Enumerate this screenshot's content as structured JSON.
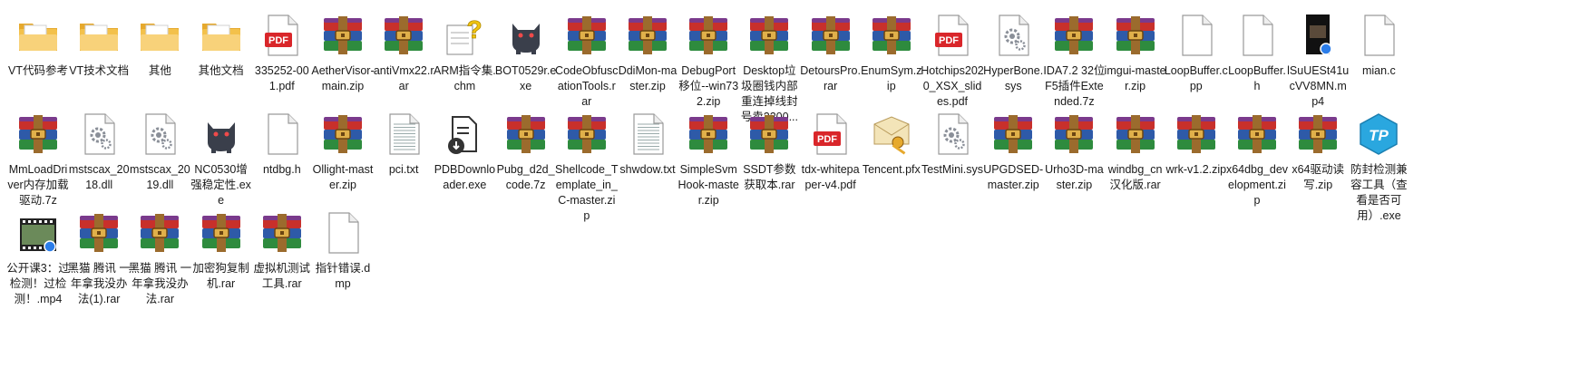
{
  "window": {
    "title": ""
  },
  "colors": {
    "folder": "#f3c14b",
    "pdf_red": "#d9262a",
    "rar_red": "#c8302b",
    "rar_blue": "#2e5aa8",
    "rar_green": "#2e8b3e",
    "rar_purple": "#7a3a8c",
    "belt": "#9b6b2d",
    "tp_blue": "#2aa7df",
    "cat": "#3a3f4b",
    "gear": "#8a8f98"
  },
  "rows": [
    [
      {
        "label": "VT代码参考",
        "type": "folder"
      },
      {
        "label": "VT技术文档",
        "type": "folder"
      },
      {
        "label": "其他",
        "type": "folder"
      },
      {
        "label": "其他文档",
        "type": "folder"
      },
      {
        "label": "335252-001.pdf",
        "type": "pdf"
      },
      {
        "label": "AetherVisor-main.zip",
        "type": "archive"
      },
      {
        "label": "antiVmx22.rar",
        "type": "archive"
      },
      {
        "label": "ARM指令集.chm",
        "type": "chm"
      },
      {
        "label": "BOT0529r.exe",
        "type": "cat-exe"
      },
      {
        "label": "CodeObfuscationTools.rar",
        "type": "archive"
      },
      {
        "label": "DdiMon-master.zip",
        "type": "archive"
      },
      {
        "label": "DebugPort移位--win732.zip",
        "type": "archive"
      },
      {
        "label": "Desktop垃圾圈钱内部重连掉线封号卖2200...",
        "type": "archive"
      },
      {
        "label": "DetoursPro.rar",
        "type": "archive"
      },
      {
        "label": "EnumSym.zip",
        "type": "archive"
      },
      {
        "label": "Hotchips2020_XSX_slides.pdf",
        "type": "pdf"
      },
      {
        "label": "HyperBone.sys",
        "type": "sys"
      },
      {
        "label": "IDA7.2 32位F5插件Extended.7z",
        "type": "archive"
      },
      {
        "label": "imgui-master.zip",
        "type": "archive"
      },
      {
        "label": "LoopBuffer.cpp",
        "type": "file"
      },
      {
        "label": "LoopBuffer.h",
        "type": "file"
      },
      {
        "label": "lSuUESt41ucVV8MN.mp4",
        "type": "video-dark"
      },
      {
        "label": "mian.c",
        "type": "file"
      }
    ],
    [
      {
        "label": "MmLoadDriver内存加载驱动.7z",
        "type": "archive"
      },
      {
        "label": "mstscax_2018.dll",
        "type": "sys"
      },
      {
        "label": "mstscax_2019.dll",
        "type": "sys"
      },
      {
        "label": "NC0530增强稳定性.exe",
        "type": "cat-exe"
      },
      {
        "label": "ntdbg.h",
        "type": "file"
      },
      {
        "label": "Ollight-master.zip",
        "type": "archive"
      },
      {
        "label": "pci.txt",
        "type": "text"
      },
      {
        "label": "PDBDownloader.exe",
        "type": "pdb-exe"
      },
      {
        "label": "Pubg_d2d_code.7z",
        "type": "archive"
      },
      {
        "label": "Shellcode_Template_in_C-master.zip",
        "type": "archive"
      },
      {
        "label": "shwdow.txt",
        "type": "text"
      },
      {
        "label": "SimpleSvmHook-master.zip",
        "type": "archive"
      },
      {
        "label": "SSDT参数获取本.rar",
        "type": "archive"
      },
      {
        "label": "tdx-whitepaper-v4.pdf",
        "type": "pdf"
      },
      {
        "label": "Tencent.pfx",
        "type": "cert"
      },
      {
        "label": "TestMini.sys",
        "type": "sys"
      },
      {
        "label": "UPGDSED-master.zip",
        "type": "archive"
      },
      {
        "label": "Urho3D-master.zip",
        "type": "archive"
      },
      {
        "label": "windbg_cn汉化版.rar",
        "type": "archive"
      },
      {
        "label": "wrk-v1.2.zip",
        "type": "archive"
      },
      {
        "label": "x64dbg_development.zip",
        "type": "archive"
      },
      {
        "label": "x64驱动读写.zip",
        "type": "archive"
      },
      {
        "label": "防封检测兼容工具（查看是否可用）.exe",
        "type": "tp-exe"
      }
    ],
    [
      {
        "label": "公开课3：过检测！过检测！.mp4",
        "type": "video-strip"
      },
      {
        "label": "黑猫 腾讯 一年拿我没办法(1).rar",
        "type": "archive"
      },
      {
        "label": "黑猫 腾讯 一年拿我没办法.rar",
        "type": "archive"
      },
      {
        "label": "加密狗复制机.rar",
        "type": "archive"
      },
      {
        "label": "虚拟机测试工具.rar",
        "type": "archive"
      },
      {
        "label": "指针错误.dmp",
        "type": "file"
      }
    ]
  ]
}
